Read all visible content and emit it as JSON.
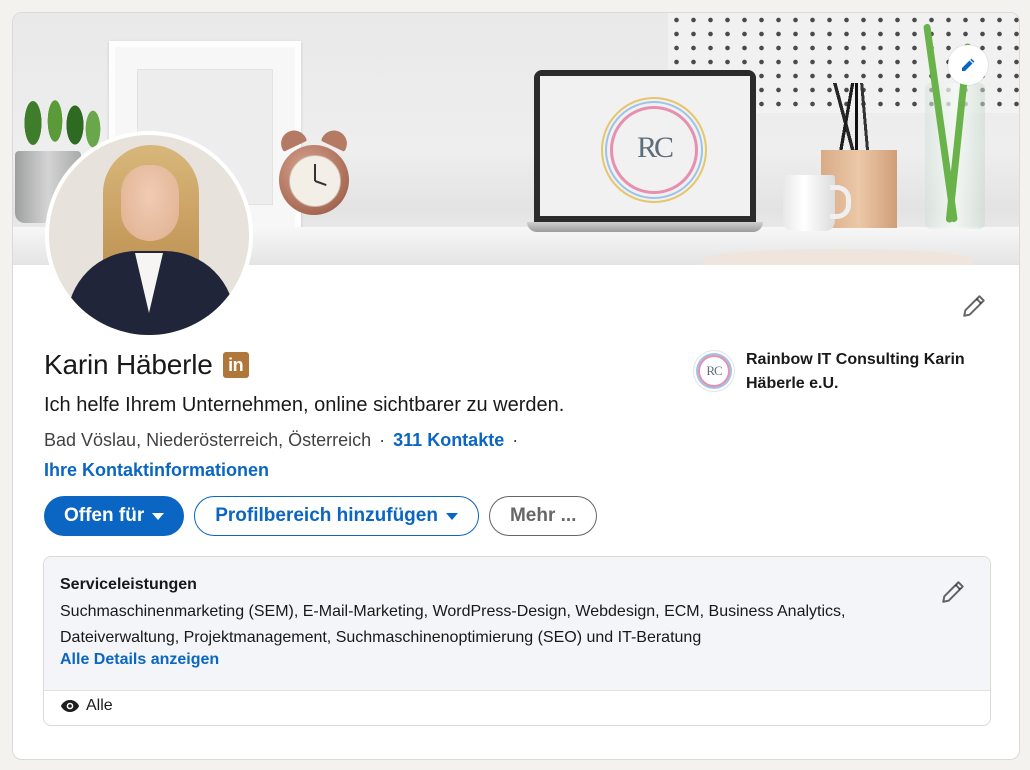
{
  "profile": {
    "name": "Karin Häberle",
    "badge_text": "in",
    "headline": "Ich helfe Ihrem Unternehmen, online sichtbarer zu werden.",
    "location": "Bad Vöslau, Niederösterreich, Österreich",
    "separator": "·",
    "connections": "311 Kontakte",
    "contact_info": "Ihre Kontaktinformationen"
  },
  "banner": {
    "laptop_logo": "RC",
    "edit_icon": "pencil-icon"
  },
  "company": {
    "logo_text": "RC",
    "name": "Rainbow IT Consulting Karin Häberle e.U."
  },
  "buttons": {
    "open_to": "Offen für",
    "add_section": "Profilbereich hinzufügen",
    "more": "Mehr ..."
  },
  "services": {
    "title": "Serviceleistungen",
    "list": "Suchmaschinenmarketing (SEM), E-Mail-Marketing, WordPress-Design, Webdesign, ECM, Business Analytics, Dateiverwaltung, Projektmanagement, Suchmaschinenoptimierung (SEO) und IT-Beratung",
    "show_all": "Alle Details anzeigen",
    "visibility": "Alle",
    "visibility_icon": "eye-icon"
  },
  "colors": {
    "primary": "#0a66c2",
    "badge": "#b0773a",
    "page_bg": "#f4f2ee",
    "services_bg": "#f3f5f8"
  }
}
